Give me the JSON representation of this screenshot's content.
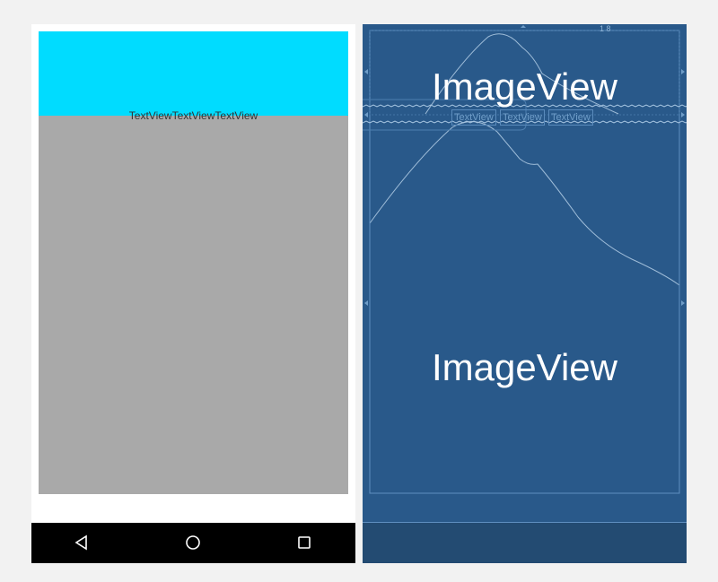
{
  "design": {
    "textviews": [
      "TextView",
      "TextView",
      "TextView"
    ]
  },
  "navbar": {
    "back_icon": "back-triangle-icon",
    "home_icon": "home-circle-icon",
    "recents_icon": "recents-square-icon"
  },
  "blueprint": {
    "top_image_label": "ImageView",
    "bottom_image_label": "ImageView",
    "textviews": [
      "TextView",
      "TextView",
      "TextView"
    ],
    "dimension_text": "1 8"
  },
  "colors": {
    "design_top": "#00dcff",
    "design_bottom": "#a9a9a9",
    "blueprint_bg": "#29598a",
    "blueprint_line": "#6f9dc8"
  }
}
